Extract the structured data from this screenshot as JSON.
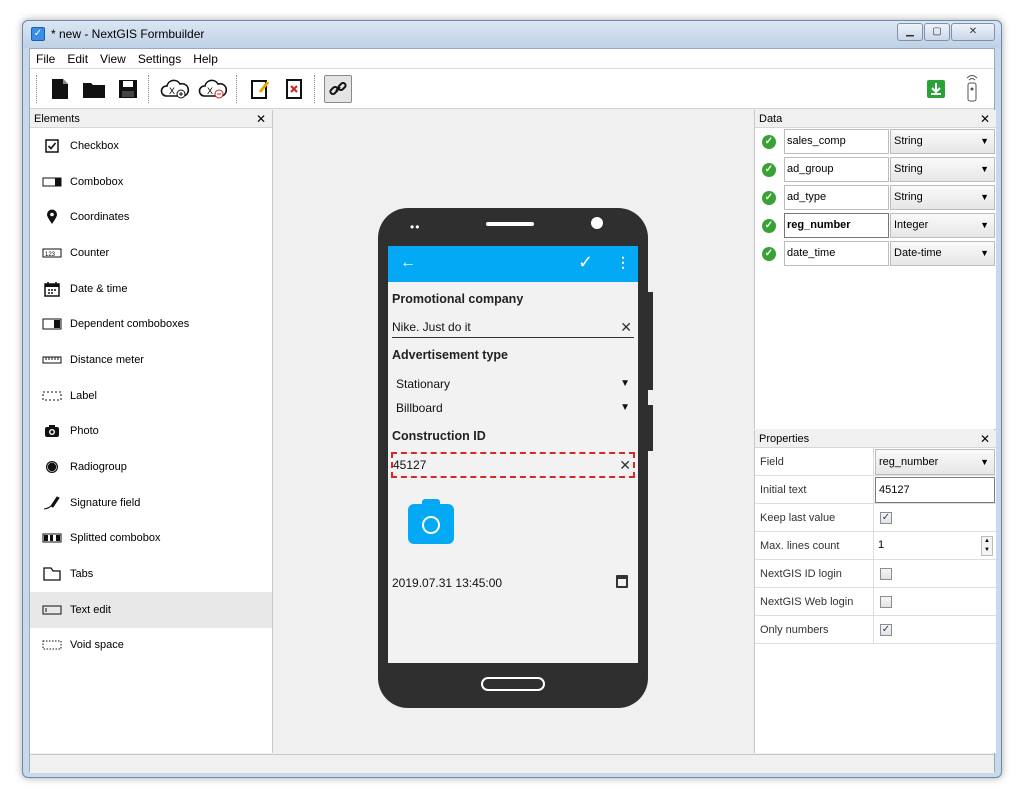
{
  "window": {
    "title": "* new - NextGIS Formbuilder"
  },
  "menu": [
    "File",
    "Edit",
    "View",
    "Settings",
    "Help"
  ],
  "toolbar": {
    "buttons": [
      "new-file-icon",
      "open-folder-icon",
      "save-icon",
      "cloud-connect-icon",
      "cloud-disconnect-icon",
      "edit-form-icon",
      "delete-form-icon",
      "link-icon",
      "download-icon",
      "remote-icon"
    ]
  },
  "elements_panel": {
    "title": "Elements",
    "items": [
      {
        "label": "Checkbox",
        "icon": "checkbox-icon"
      },
      {
        "label": "Combobox",
        "icon": "combobox-icon"
      },
      {
        "label": "Coordinates",
        "icon": "pin-icon"
      },
      {
        "label": "Counter",
        "icon": "counter-icon"
      },
      {
        "label": "Date & time",
        "icon": "calendar-icon"
      },
      {
        "label": "Dependent comboboxes",
        "icon": "combobox-icon"
      },
      {
        "label": "Distance meter",
        "icon": "ruler-icon"
      },
      {
        "label": "Label",
        "icon": "label-icon"
      },
      {
        "label": "Photo",
        "icon": "camera-icon"
      },
      {
        "label": "Radiogroup",
        "icon": "radio-icon"
      },
      {
        "label": "Signature field",
        "icon": "signature-icon"
      },
      {
        "label": "Splitted combobox",
        "icon": "split-combo-icon"
      },
      {
        "label": "Tabs",
        "icon": "tabs-icon"
      },
      {
        "label": "Text edit",
        "icon": "text-edit-icon"
      },
      {
        "label": "Void space",
        "icon": "void-icon"
      }
    ],
    "selected": "Text edit"
  },
  "phone_form": {
    "label1": "Promotional company",
    "field1": "Nike. Just do it",
    "label2": "Advertisement type",
    "combo1": "Stationary",
    "combo2": "Billboard",
    "label3": "Construction ID",
    "field2": "45127",
    "datetime": "2019.07.31 13:45:00"
  },
  "data_panel": {
    "title": "Data",
    "rows": [
      {
        "field": "sales_comp",
        "type": "String"
      },
      {
        "field": "ad_group",
        "type": "String"
      },
      {
        "field": "ad_type",
        "type": "String"
      },
      {
        "field": "reg_number",
        "type": "Integer"
      },
      {
        "field": "date_time",
        "type": "Date-time"
      }
    ]
  },
  "properties_panel": {
    "title": "Properties",
    "rows": [
      {
        "name": "Field",
        "value": "reg_number"
      },
      {
        "name": "Initial text",
        "value": "45127"
      },
      {
        "name": "Keep last value",
        "checked": true
      },
      {
        "name": "Max. lines count",
        "value": "1"
      },
      {
        "name": "NextGIS ID login",
        "checked": false
      },
      {
        "name": "NextGIS Web login",
        "checked": false
      },
      {
        "name": "Only numbers",
        "checked": true
      }
    ]
  },
  "colors": {
    "accent": "#03a9f4",
    "ok": "#38a235",
    "selection": "#d62a2a"
  }
}
